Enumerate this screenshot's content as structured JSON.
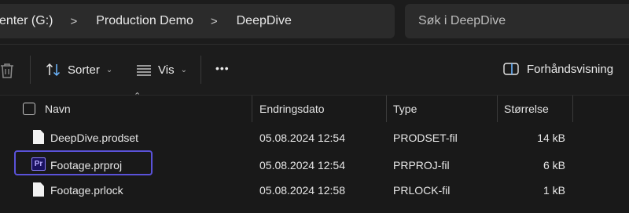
{
  "breadcrumb": {
    "items": [
      "enter (G:)",
      "Production Demo",
      "DeepDive"
    ],
    "separator": ">"
  },
  "search": {
    "placeholder": "Søk i DeepDive"
  },
  "toolbar": {
    "sort_label": "Sorter",
    "view_label": "Vis",
    "more_label": "•••",
    "preview_label": "Forhåndsvisning"
  },
  "columns": {
    "name": "Navn",
    "date": "Endringsdato",
    "type": "Type",
    "size": "Størrelse"
  },
  "files": [
    {
      "name": "DeepDive.prodset",
      "date": "05.08.2024 12:54",
      "type": "PRODSET-fil",
      "size": "14 kB",
      "icon": "document-icon"
    },
    {
      "name": "Footage.prproj",
      "date": "05.08.2024 12:54",
      "type": "PRPROJ-fil",
      "size": "6 kB",
      "icon": "premiere-pro-icon",
      "icon_text": "Pr",
      "selected": true
    },
    {
      "name": "Footage.prlock",
      "date": "05.08.2024 12:58",
      "type": "PRLOCK-fil",
      "size": "1 kB",
      "icon": "document-icon"
    }
  ],
  "colors": {
    "background": "#191919",
    "panel": "#2b2b2b",
    "selection_border": "#5a52d9",
    "premiere_icon": "#1a1260"
  }
}
